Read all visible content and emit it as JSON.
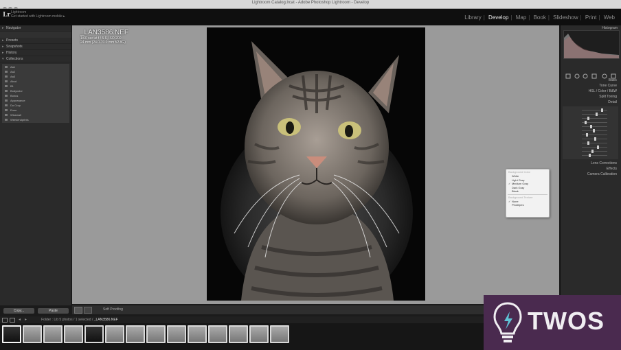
{
  "window": {
    "title": "Lightroom Catalog.lrcat - Adobe Photoshop Lightroom - Develop"
  },
  "identity": {
    "logo": "Lr",
    "catalog_title": "Lightroom",
    "catalog_subtitle": "Get started with Lightroom mobile ▸"
  },
  "modules": {
    "items": [
      "Library",
      "Develop",
      "Map",
      "Book",
      "Slideshow",
      "Print",
      "Web"
    ],
    "active": "Develop"
  },
  "left_panel": {
    "sections": [
      "Navigator",
      "Presets",
      "Snapshots",
      "History",
      "Collections"
    ],
    "collections": [
      "Aa1",
      "Aa2",
      "Aa3",
      "Abcd",
      "B1",
      "Bodycolor",
      "Bonus",
      "Appearance",
      "Do Crop",
      "Emsr",
      "Wisewall",
      "Weekendprints"
    ],
    "copy_label": "Copy...",
    "paste_label": "Paste"
  },
  "loupe": {
    "filename": "_LAN3586.NEF",
    "exposure": "1/60 sec at f / 5.6, ISO 200",
    "lens": "24 mm (24.0-70.0 mm f/2.8G)"
  },
  "context_menu": {
    "header1": "Background Color",
    "items1": [
      {
        "label": "White",
        "checked": false
      },
      {
        "label": "Light Gray",
        "checked": false
      },
      {
        "label": "Medium Gray",
        "checked": true
      },
      {
        "label": "Dark Gray",
        "checked": false
      },
      {
        "label": "Black",
        "checked": false
      }
    ],
    "header2": "Background Texture",
    "items2": [
      {
        "label": "None",
        "checked": true
      },
      {
        "label": "Pinstripes",
        "checked": false
      }
    ]
  },
  "right_panel": {
    "histogram_label": "Histogram",
    "sections": [
      "Basic",
      "Tone Curve",
      "HSL / Color / B&W",
      "Split Toning",
      "Detail",
      "Lens Corrections",
      "Effects",
      "Camera Calibration"
    ]
  },
  "toolbar": {
    "soft_proofing": "Soft Proofing"
  },
  "filmstrip": {
    "breadcrumb_prefix": "Folder : Lib",
    "breadcrumb_mid": "5 photos / 1 selected /",
    "current_file": "_LAN3586.NEF",
    "thumbnail_count": 14
  },
  "watermark": {
    "text": "TWOS"
  }
}
